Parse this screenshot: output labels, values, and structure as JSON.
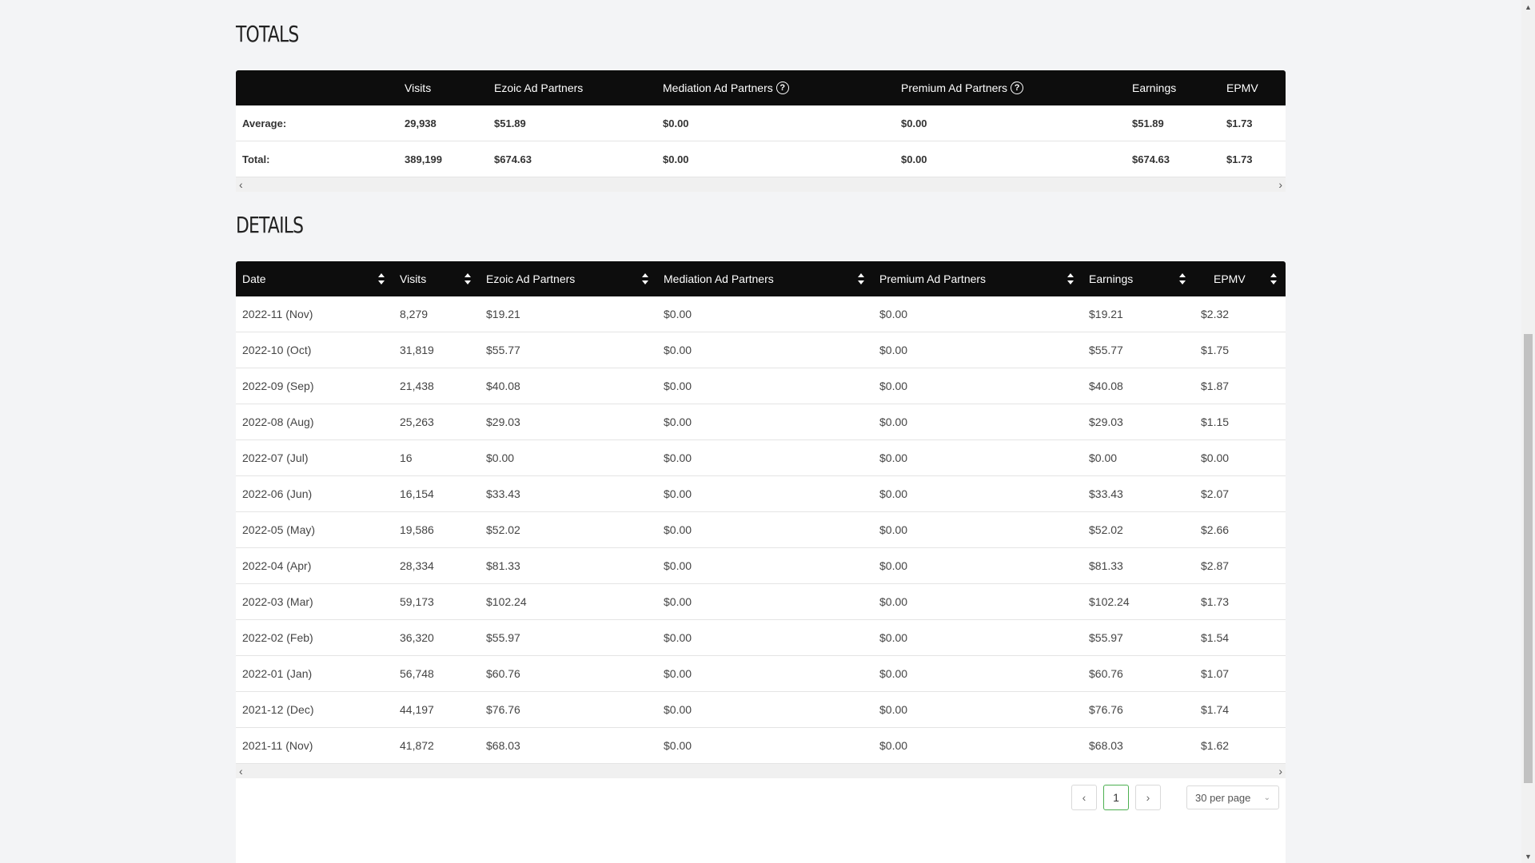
{
  "totals": {
    "title": "TOTALS",
    "headers": [
      "",
      "Visits",
      "Ezoic Ad Partners",
      "Mediation Ad Partners",
      "Premium Ad Partners",
      "Earnings",
      "EPMV"
    ],
    "rows": [
      [
        "Average:",
        "29,938",
        "$51.89",
        "$0.00",
        "$0.00",
        "$51.89",
        "$1.73"
      ],
      [
        "Total:",
        "389,199",
        "$674.63",
        "$0.00",
        "$0.00",
        "$674.63",
        "$1.73"
      ]
    ]
  },
  "details": {
    "title": "DETAILS",
    "headers": [
      "Date",
      "Visits",
      "Ezoic Ad Partners",
      "Mediation Ad Partners",
      "Premium Ad Partners",
      "Earnings",
      "EPMV"
    ],
    "rows": [
      [
        "2022-11 (Nov)",
        "8,279",
        "$19.21",
        "$0.00",
        "$0.00",
        "$19.21",
        "$2.32"
      ],
      [
        "2022-10 (Oct)",
        "31,819",
        "$55.77",
        "$0.00",
        "$0.00",
        "$55.77",
        "$1.75"
      ],
      [
        "2022-09 (Sep)",
        "21,438",
        "$40.08",
        "$0.00",
        "$0.00",
        "$40.08",
        "$1.87"
      ],
      [
        "2022-08 (Aug)",
        "25,263",
        "$29.03",
        "$0.00",
        "$0.00",
        "$29.03",
        "$1.15"
      ],
      [
        "2022-07 (Jul)",
        "16",
        "$0.00",
        "$0.00",
        "$0.00",
        "$0.00",
        "$0.00"
      ],
      [
        "2022-06 (Jun)",
        "16,154",
        "$33.43",
        "$0.00",
        "$0.00",
        "$33.43",
        "$2.07"
      ],
      [
        "2022-05 (May)",
        "19,586",
        "$52.02",
        "$0.00",
        "$0.00",
        "$52.02",
        "$2.66"
      ],
      [
        "2022-04 (Apr)",
        "28,334",
        "$81.33",
        "$0.00",
        "$0.00",
        "$81.33",
        "$2.87"
      ],
      [
        "2022-03 (Mar)",
        "59,173",
        "$102.24",
        "$0.00",
        "$0.00",
        "$102.24",
        "$1.73"
      ],
      [
        "2022-02 (Feb)",
        "36,320",
        "$55.97",
        "$0.00",
        "$0.00",
        "$55.97",
        "$1.54"
      ],
      [
        "2022-01 (Jan)",
        "56,748",
        "$60.76",
        "$0.00",
        "$0.00",
        "$60.76",
        "$1.07"
      ],
      [
        "2021-12 (Dec)",
        "44,197",
        "$76.76",
        "$0.00",
        "$0.00",
        "$76.76",
        "$1.74"
      ],
      [
        "2021-11 (Nov)",
        "41,872",
        "$68.03",
        "$0.00",
        "$0.00",
        "$68.03",
        "$1.62"
      ]
    ]
  },
  "pagination": {
    "current_page": "1",
    "per_page": "30 per page"
  }
}
